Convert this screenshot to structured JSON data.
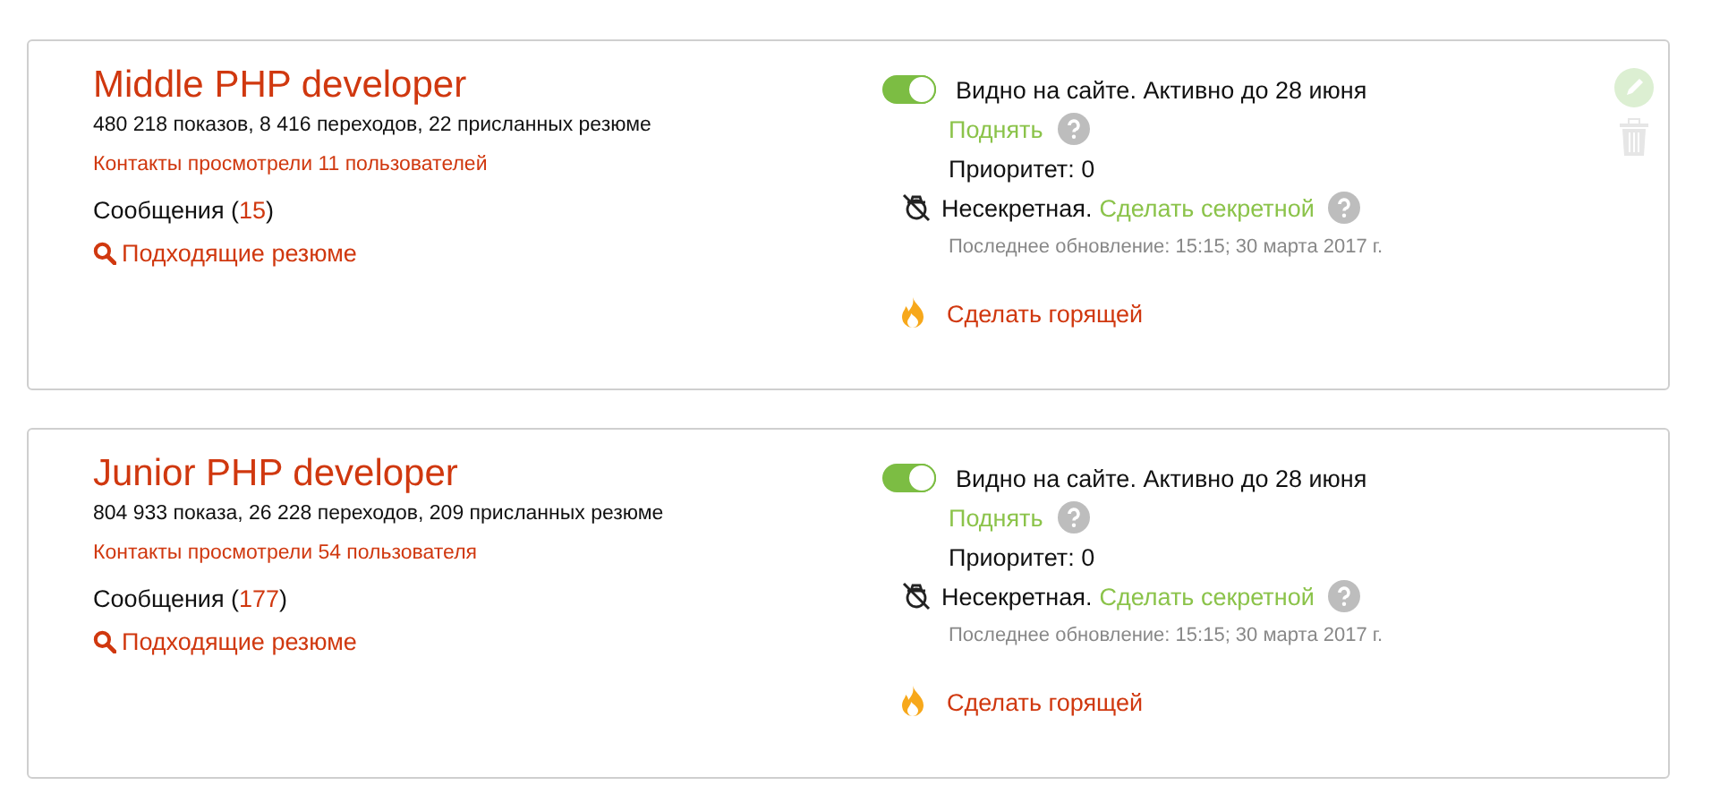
{
  "vacancies": [
    {
      "title": "Middle PHP developer",
      "stats": "480 218 показов, 8 416 переходов, 22 присланных резюме",
      "contacts": "Контакты просмотрели 11 пользователей",
      "messages": {
        "label": "Сообщения (",
        "count": "15",
        "suffix": ")"
      },
      "matching": "Подходящие резюме",
      "visible": true,
      "visibility": "Видно на сайте. Активно до 28 июня",
      "raise": "Поднять",
      "priority": "Приоритет: 0",
      "secrecy": "Несекретная.",
      "make_secret": "Сделать секретной",
      "updated": "Последнее обновление: 15:15; 30 марта 2017 г.",
      "hot": "Сделать горящей",
      "actions": true
    },
    {
      "title": "Junior PHP developer",
      "stats": "804 933 показа, 26 228 переходов, 209 присланных резюме",
      "contacts": "Контакты просмотрели 54 пользователя",
      "messages": {
        "label": "Сообщения (",
        "count": "177",
        "suffix": ")"
      },
      "matching": "Подходящие резюме",
      "visible": true,
      "visibility": "Видно на сайте. Активно до 28 июня",
      "raise": "Поднять",
      "priority": "Приоритет: 0",
      "secrecy": "Несекретная.",
      "make_secret": "Сделать секретной",
      "updated": "Последнее обновление: 15:15; 30 марта 2017 г.",
      "hot": "Сделать горящей",
      "actions": false
    }
  ]
}
